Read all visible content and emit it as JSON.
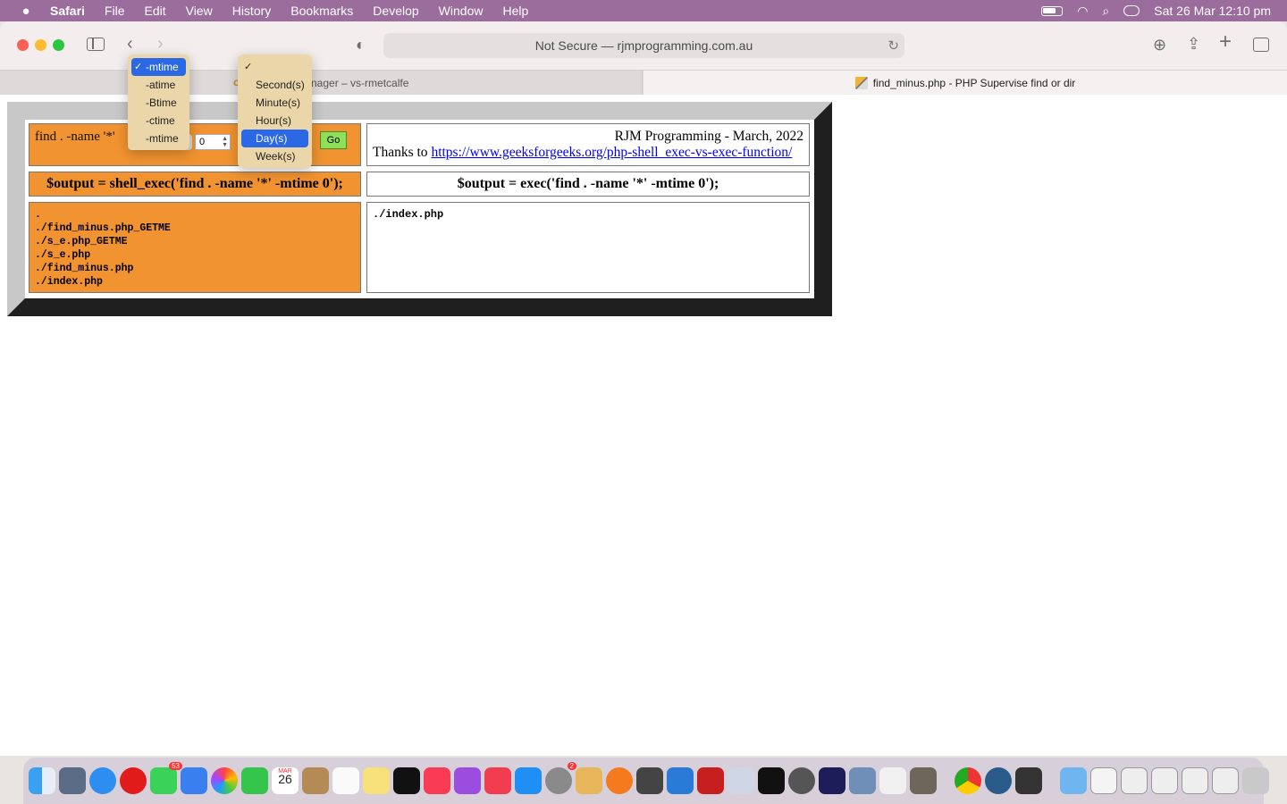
{
  "menubar": {
    "app_name": "Safari",
    "items": [
      "File",
      "Edit",
      "View",
      "History",
      "Bookmarks",
      "Develop",
      "Window",
      "Help"
    ],
    "clock": "Sat 26 Mar  12:10 pm"
  },
  "toolbar": {
    "url": "Not Secure — rjmprogramming.com.au"
  },
  "tabs": [
    {
      "label": "nager – vs-rmetcalfe",
      "badge": "c"
    },
    {
      "label": "find_minus.php - PHP Supervise find or dir"
    }
  ],
  "page": {
    "find_prefix": "find . -name '*'",
    "number_value": "0",
    "go_label": "Go",
    "credit_line": "RJM Programming - March, 2022",
    "thanks_prefix": "Thanks to ",
    "thanks_link": "https://www.geeksforgeeks.org/php-shell_exec-vs-exec-function/",
    "shell_exec_heading": "$output = shell_exec('find . -name '*' -mtime 0');",
    "exec_heading": "$output = exec('find . -name '*' -mtime 0');",
    "shell_exec_output": ".\n./find_minus.php_GETME\n./s_e.php_GETME\n./s_e.php\n./find_minus.php\n./index.php",
    "exec_output": "./index.php"
  },
  "time_type_menu": {
    "options": [
      "-mtime",
      "-atime",
      "-Btime",
      "-ctime",
      "-mtime"
    ],
    "selected_index": 0
  },
  "unit_menu": {
    "options": [
      "",
      "Second(s)",
      "Minute(s)",
      "Hour(s)",
      "Day(s)",
      "Week(s)"
    ],
    "checked_index": 0,
    "highlighted_index": 4
  },
  "dock": {
    "calendar_month": "MAR",
    "calendar_day": "26",
    "messages_badge": "53",
    "settings_badge": "2"
  },
  "colors": {
    "menubar": "#9a6d9c",
    "orange_cell": "#f19330",
    "go_button": "#8ee05a",
    "popup_bg": "#ead6a8",
    "selection": "#2a68e6"
  }
}
